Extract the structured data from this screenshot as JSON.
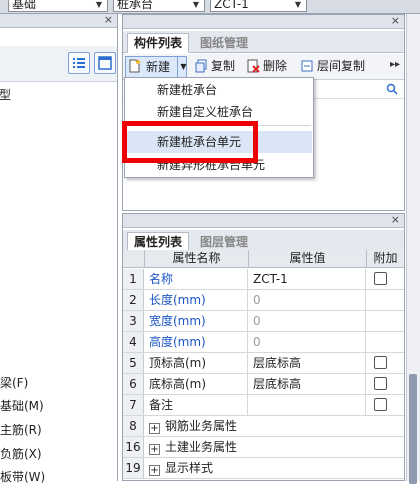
{
  "topbar": {
    "selects": [
      {
        "value": "基础"
      },
      {
        "value": "桩承台"
      },
      {
        "value": "ZCT-1"
      }
    ]
  },
  "left_panel": {
    "partial_items": [
      "型",
      "梁(F)",
      "基础(M)",
      "主筋(R)",
      "负筋(X)",
      "板带(W)"
    ]
  },
  "component_panel": {
    "tabs": [
      {
        "label": "构件列表",
        "active": true
      },
      {
        "label": "图纸管理",
        "active": false
      }
    ],
    "toolbar": {
      "new_label": "新建",
      "copy_label": "复制",
      "delete_label": "删除",
      "floor_copy_label": "层间复制"
    },
    "new_menu": {
      "items": [
        {
          "label": "新建桩承台",
          "highlighted": false
        },
        {
          "label": "新建自定义桩承台",
          "highlighted": false
        },
        {
          "label": "新建桩承台单元",
          "highlighted": true
        },
        {
          "label": "新建异形桩承台单元",
          "highlighted": false
        }
      ]
    }
  },
  "property_panel": {
    "tabs": [
      {
        "label": "属性列表",
        "active": true
      },
      {
        "label": "图层管理",
        "active": false
      }
    ],
    "columns": [
      "属性名称",
      "属性值",
      "附加"
    ],
    "rows": [
      {
        "num": "1",
        "name": "名称",
        "value": "ZCT-1",
        "blue": true,
        "gray": false,
        "checkbox": true,
        "group": false
      },
      {
        "num": "2",
        "name": "长度(mm)",
        "value": "0",
        "blue": true,
        "gray": true,
        "checkbox": false,
        "group": false
      },
      {
        "num": "3",
        "name": "宽度(mm)",
        "value": "0",
        "blue": true,
        "gray": true,
        "checkbox": false,
        "group": false
      },
      {
        "num": "4",
        "name": "高度(mm)",
        "value": "0",
        "blue": true,
        "gray": true,
        "checkbox": false,
        "group": false
      },
      {
        "num": "5",
        "name": "顶标高(m)",
        "value": "层底标高",
        "blue": false,
        "gray": false,
        "checkbox": true,
        "group": false
      },
      {
        "num": "6",
        "name": "底标高(m)",
        "value": "层底标高",
        "blue": false,
        "gray": false,
        "checkbox": true,
        "group": false
      },
      {
        "num": "7",
        "name": "备注",
        "value": "",
        "blue": false,
        "gray": false,
        "checkbox": true,
        "group": false
      },
      {
        "num": "8",
        "name": "钢筋业务属性",
        "value": "",
        "blue": false,
        "gray": false,
        "checkbox": false,
        "group": true
      },
      {
        "num": "16",
        "name": "土建业务属性",
        "value": "",
        "blue": false,
        "gray": false,
        "checkbox": false,
        "group": true
      },
      {
        "num": "19",
        "name": "显示样式",
        "value": "",
        "blue": false,
        "gray": false,
        "checkbox": false,
        "group": true
      }
    ],
    "expander_symbol": "+"
  },
  "icons": {
    "close": "close-icon",
    "dropdown": "chevron-down-icon",
    "more": "double-chevron-right-icon"
  }
}
